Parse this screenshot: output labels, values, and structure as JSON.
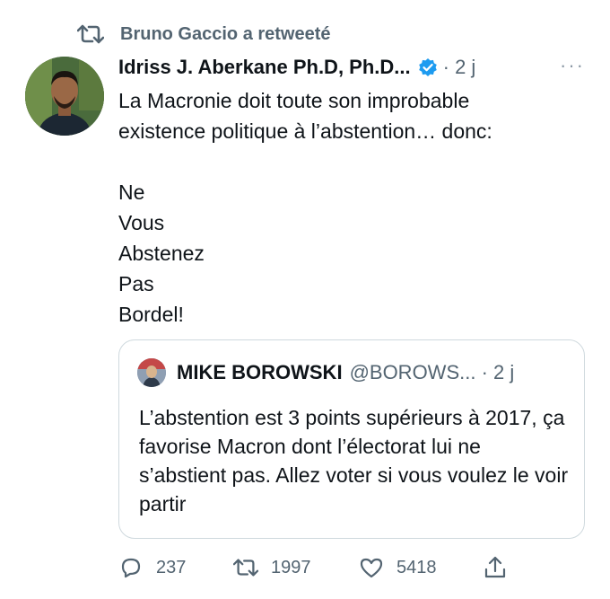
{
  "retweet": {
    "label": "Bruno Gaccio a retweeté"
  },
  "tweet": {
    "author_name": "Idriss J. Aberkane Ph.D, Ph.D...",
    "meta": "· 2 j",
    "more": "···",
    "text": "La Macronie doit toute son improbable\nexistence politique à l’abstention… donc:\n\nNe\nVous\nAbstenez\nPas\nBordel!"
  },
  "quote": {
    "author_name": "MIKE BOROWSKI",
    "handle_meta": "@BOROWS... · 2 j",
    "text": "L’abstention est 3 points supérieurs à 2017, ça favorise Macron dont l’électorat lui ne s’abstient pas. Allez voter si vous voulez le voir partir"
  },
  "actions": {
    "replies": "237",
    "retweets": "1997",
    "likes": "5418"
  },
  "colors": {
    "verified": "#1d9bf0",
    "muted": "#536471",
    "text": "#0f1419",
    "border": "#cfd9de"
  },
  "icons": [
    "retweet-icon",
    "verified-badge-icon",
    "more-icon",
    "reply-icon",
    "like-icon",
    "share-icon"
  ]
}
